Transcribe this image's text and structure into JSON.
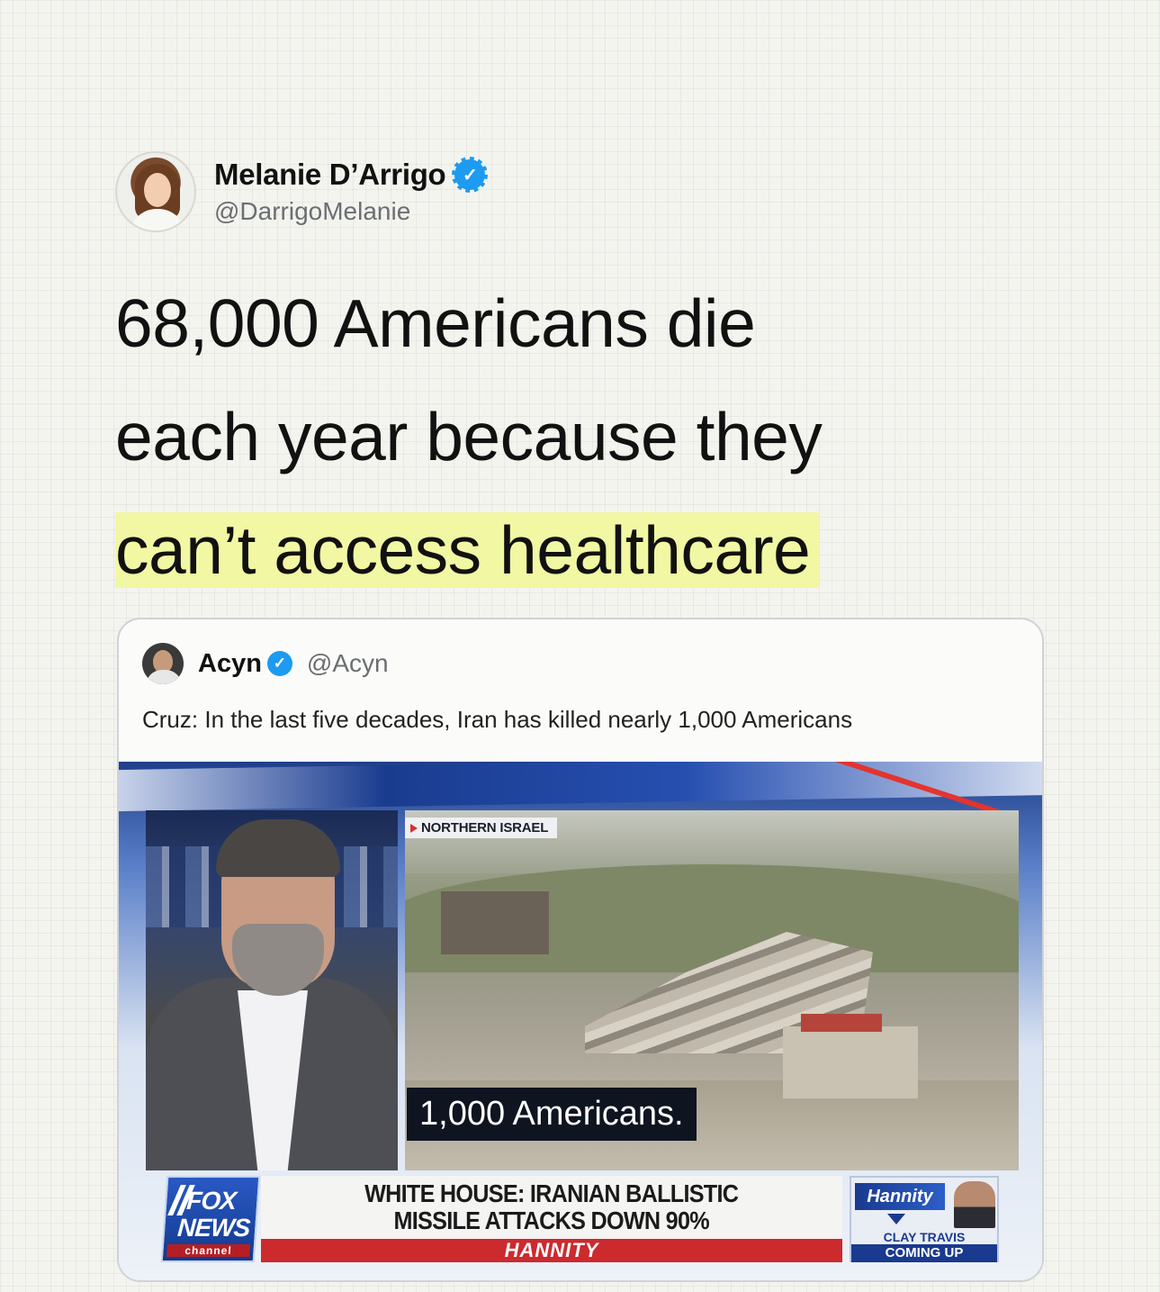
{
  "author": {
    "name": "Melanie D’Arrigo",
    "handle": "@DarrigoMelanie",
    "verified_glyph": "✓"
  },
  "headline": {
    "line1": "68,000 Americans die",
    "line2": "each year because they",
    "line3_highlighted": "can’t access healthcare",
    "highlight_color": "#f2f7a4"
  },
  "quote": {
    "name": "Acyn",
    "handle": "@Acyn",
    "verified_glyph": "✓",
    "text": "Cruz: In the last five decades, Iran has killed nearly 1,000 Americans",
    "video": {
      "location_tag": "NORTHERN ISRAEL",
      "subtitle": "1,000 Americans.",
      "network": {
        "line1": "FOX",
        "line2": "NEWS",
        "line3": "channel"
      },
      "chyron": {
        "line1": "WHITE HOUSE: IRANIAN BALLISTIC",
        "line2": "MISSILE ATTACKS DOWN 90%",
        "show": "HANNITY"
      },
      "promo": {
        "logo": "Hannity",
        "sub1": "CLAY TRAVIS",
        "sub2": "COMING UP"
      }
    }
  },
  "colors": {
    "verified_blue": "#1d9bf0",
    "fox_red": "#cd2a2e",
    "fox_blue": "#1a3a8f"
  }
}
